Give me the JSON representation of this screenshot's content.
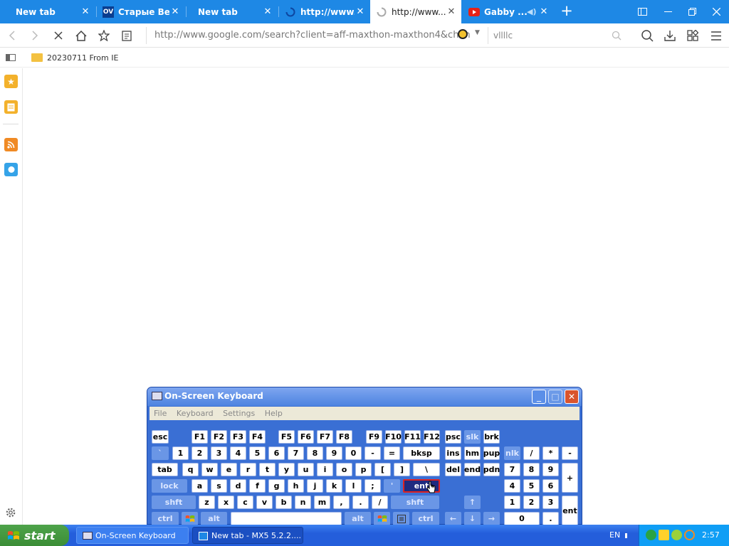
{
  "browser": {
    "tabs": [
      {
        "label": "New tab",
        "favicon": "none",
        "close": "✕"
      },
      {
        "label": "Старые Вер...",
        "favicon": "ov-logo",
        "favicon_text": "OV",
        "close": "✕"
      },
      {
        "label": "New tab",
        "favicon": "none",
        "close": "✕"
      },
      {
        "label": "http://www....",
        "favicon": "loading-spinner",
        "close": "✕"
      },
      {
        "label": "http://www....",
        "favicon": "loading-spinner",
        "close": "✕",
        "active": true
      },
      {
        "label": "Gabby ...",
        "favicon": "youtube-logo",
        "close": "✕",
        "audio": "speaker-icon"
      }
    ],
    "new_tab": "+",
    "window_buttons": [
      "sidebar-toggle-icon",
      "minimize-icon",
      "restore-icon",
      "close-icon"
    ],
    "nav": {
      "back": "←",
      "forward": "→",
      "reload": "stop-loading-icon",
      "home": "home-icon",
      "favorite": "star-icon",
      "reader": "reader-icon"
    },
    "address": "http://www.google.com/search?client=aff-maxthon-maxthon4&chan",
    "search_value": "vllllc",
    "tools": [
      "search-icon",
      "magnifier-icon",
      "download-icon",
      "extensions-icon",
      "menu-icon"
    ],
    "bookmark": "20230711 From IE",
    "sidebar_icons": [
      "favorites-icon",
      "notes-icon",
      "rss-icon",
      "bubble-icon",
      "settings-icon"
    ]
  },
  "osk": {
    "title": "On-Screen Keyboard",
    "menu": [
      "File",
      "Keyboard",
      "Settings",
      "Help"
    ],
    "title_buttons": [
      "minimize",
      "maximize",
      "close"
    ],
    "highlighted_key": "ent",
    "keys": [
      "esc",
      "F1",
      "F2",
      "F3",
      "F4",
      "F5",
      "F6",
      "F7",
      "F8",
      "F9",
      "F10",
      "F11",
      "F12",
      "psc",
      "slk",
      "brk",
      "`",
      "1",
      "2",
      "3",
      "4",
      "5",
      "6",
      "7",
      "8",
      "9",
      "0",
      "-",
      "=",
      "bksp",
      "ins",
      "hm",
      "pup",
      "nlk",
      "/",
      "*",
      "-",
      "tab",
      "q",
      "w",
      "e",
      "r",
      "t",
      "y",
      "u",
      "i",
      "o",
      "p",
      "[",
      "]",
      "\\",
      "del",
      "end",
      "pdn",
      "7",
      "8",
      "9",
      "+",
      "lock",
      "a",
      "s",
      "d",
      "f",
      "g",
      "h",
      "j",
      "k",
      "l",
      ";",
      "'",
      "ent",
      "4",
      "5",
      "6",
      "shft",
      "z",
      "x",
      "c",
      "v",
      "b",
      "n",
      "m",
      ",",
      ".",
      "/",
      "shft",
      "↑",
      "1",
      "2",
      "3",
      "ent",
      "ctrl",
      "win",
      "alt",
      "",
      "alt",
      "win",
      "menu",
      "ctrl",
      "←",
      "↓",
      "→",
      "0",
      "."
    ]
  },
  "taskbar": {
    "start": "start",
    "items": [
      {
        "label": "On-Screen Keyboard",
        "icon": "keyboard-icon"
      },
      {
        "label": "New tab - MX5 5.2.2....",
        "icon": "maxthon-icon"
      }
    ],
    "lang": "EN",
    "clock": "2:57",
    "colors": {
      "taskbar": "#245edb",
      "tray": "#0f9ef5",
      "start": "#3b8d36",
      "tabbar": "#1e88e5"
    }
  }
}
